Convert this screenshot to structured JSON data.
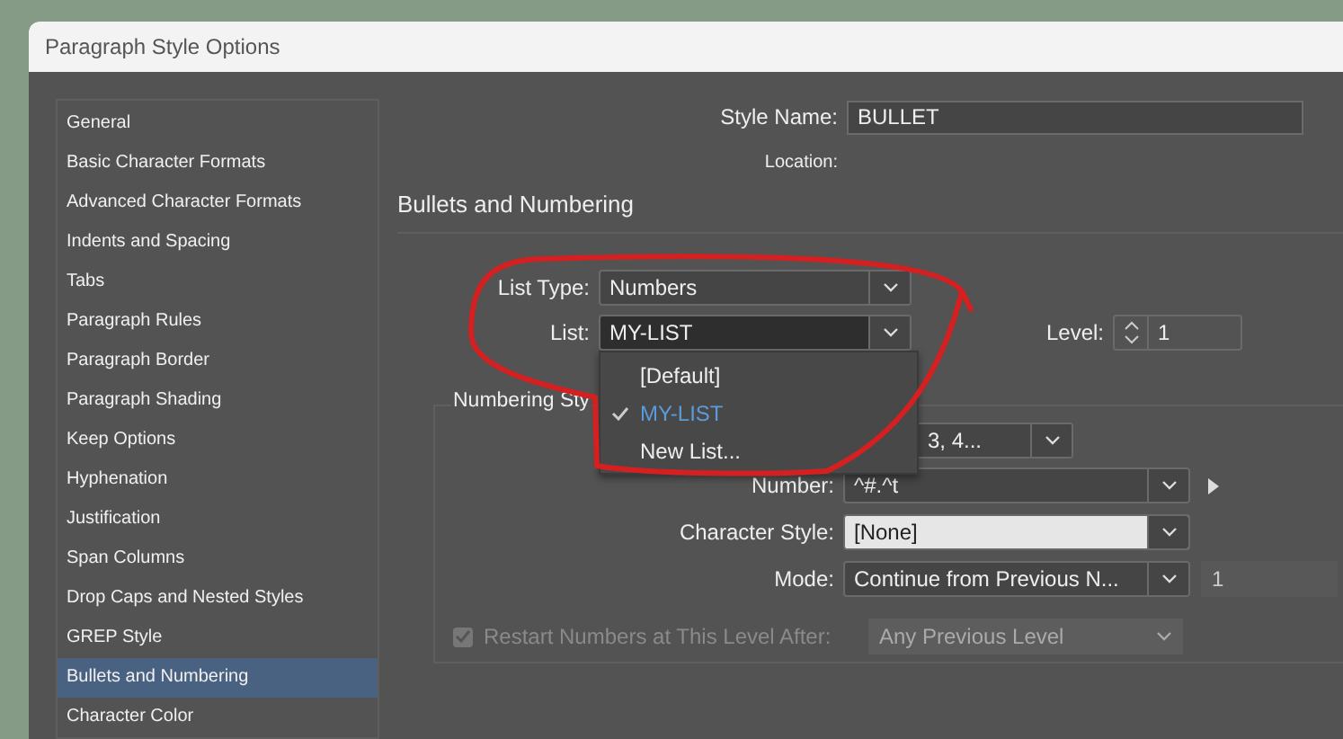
{
  "window": {
    "title": "Paragraph Style Options"
  },
  "sidebar": {
    "items": [
      {
        "label": "General",
        "selected": false
      },
      {
        "label": "Basic Character Formats",
        "selected": false
      },
      {
        "label": "Advanced Character Formats",
        "selected": false
      },
      {
        "label": "Indents and Spacing",
        "selected": false
      },
      {
        "label": "Tabs",
        "selected": false
      },
      {
        "label": "Paragraph Rules",
        "selected": false
      },
      {
        "label": "Paragraph Border",
        "selected": false
      },
      {
        "label": "Paragraph Shading",
        "selected": false
      },
      {
        "label": "Keep Options",
        "selected": false
      },
      {
        "label": "Hyphenation",
        "selected": false
      },
      {
        "label": "Justification",
        "selected": false
      },
      {
        "label": "Span Columns",
        "selected": false
      },
      {
        "label": "Drop Caps and Nested Styles",
        "selected": false
      },
      {
        "label": "GREP Style",
        "selected": false
      },
      {
        "label": "Bullets and Numbering",
        "selected": true
      },
      {
        "label": "Character Color",
        "selected": false
      }
    ]
  },
  "style_name": {
    "label": "Style Name:",
    "value": "BULLET"
  },
  "location": {
    "label": "Location:"
  },
  "section_title": "Bullets and Numbering",
  "list_type": {
    "label": "List Type:",
    "value": "Numbers"
  },
  "list": {
    "label": "List:",
    "value": "MY-LIST"
  },
  "level": {
    "label": "Level:",
    "value": "1"
  },
  "list_menu": {
    "items": [
      {
        "label": "[Default]",
        "selected": false
      },
      {
        "label": "MY-LIST",
        "selected": true
      },
      {
        "label": "New List...",
        "selected": false
      }
    ]
  },
  "numbering_style": {
    "title": "Numbering Sty",
    "format_value": "3, 4...",
    "number": {
      "label": "Number:",
      "value": "^#.^t"
    },
    "character_style": {
      "label": "Character Style:",
      "value": "[None]"
    },
    "mode": {
      "label": "Mode:",
      "value": "Continue from Previous N...",
      "start": "1"
    },
    "restart": {
      "label": "Restart Numbers at This Level After:",
      "checked": true,
      "disabled": true,
      "value": "Any Previous Level"
    }
  }
}
